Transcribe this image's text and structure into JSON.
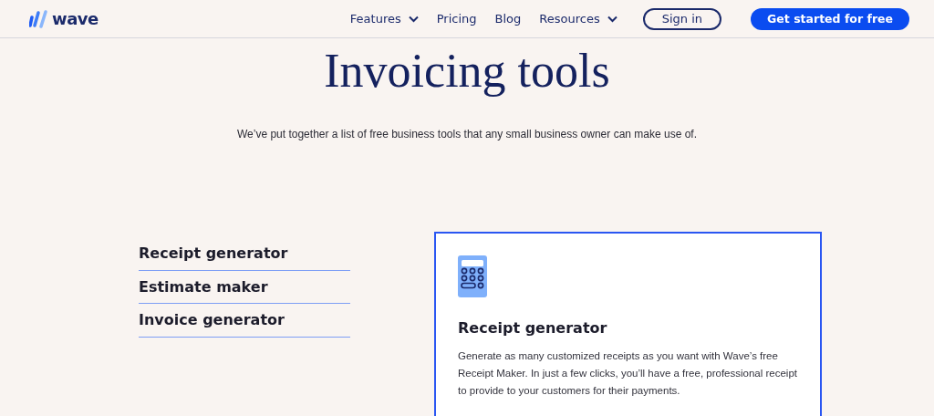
{
  "header": {
    "logo": "wave",
    "nav": [
      {
        "label": "Features",
        "dropdown": true
      },
      {
        "label": "Pricing",
        "dropdown": false
      },
      {
        "label": "Blog",
        "dropdown": false
      },
      {
        "label": "Resources",
        "dropdown": true
      }
    ],
    "sign_in": "Sign in",
    "cta": "Get started for free"
  },
  "hero": {
    "title": "Invoicing tools",
    "subtitle": "We’ve put together a list of free business tools that any small business owner can make use of."
  },
  "tools": [
    {
      "label": "Receipt generator"
    },
    {
      "label": "Estimate maker"
    },
    {
      "label": "Invoice generator"
    }
  ],
  "card": {
    "title": "Receipt generator",
    "body": "Generate as many customized receipts as you want with Wave’s free Receipt Maker. In just a few clicks, you’ll have a free, professional receipt to provide to your customers for their payments."
  }
}
